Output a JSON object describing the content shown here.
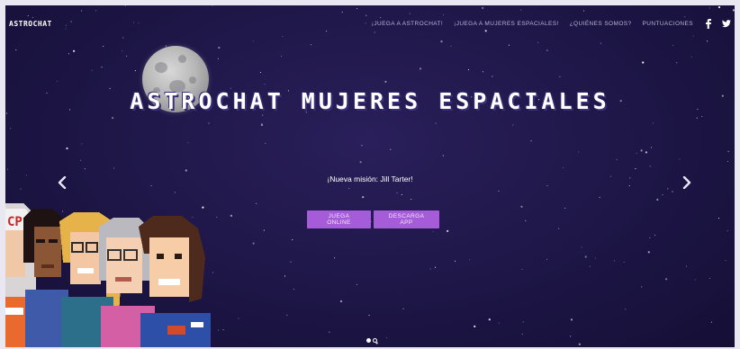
{
  "navbar": {
    "brand": "ASTROCHAT",
    "links": [
      "¡JUEGA A ASTROCHAT!",
      "¡JUEGA A MUJERES ESPACIALES!",
      "¿QUIÉNES SOMOS?",
      "PUNTUACIONES"
    ],
    "social": [
      "facebook-icon",
      "twitter-icon"
    ]
  },
  "hero": {
    "title": "ASTROCHAT MUJERES ESPACIALES",
    "subtitle": "¡Nueva misión: Jill Tarter!",
    "buttons": {
      "online": "JUEGA ONLINE",
      "app": "DESCARGA APP"
    },
    "badge_text": "CP",
    "carousel": {
      "slides": 2,
      "active": 1
    }
  },
  "colors": {
    "background": "#1d1646",
    "button": "#a65cd8",
    "nav_text": "#b8b3d8"
  }
}
